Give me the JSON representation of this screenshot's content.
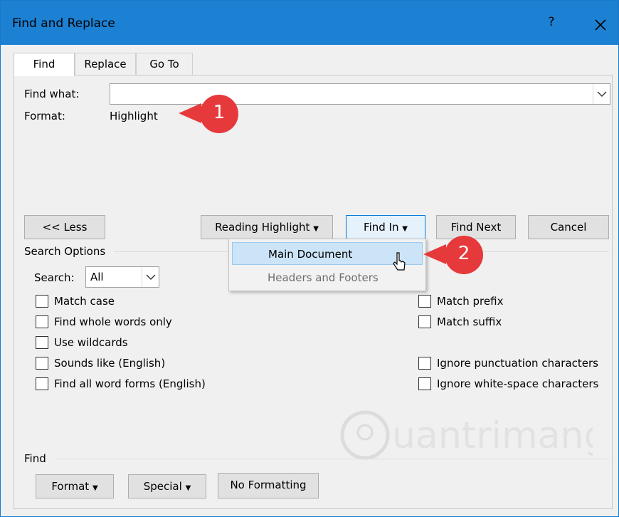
{
  "window": {
    "title": "Find and Replace",
    "help_label": "?",
    "close_icon": "close-icon",
    "title_bar_color": "#1c80d3"
  },
  "tabs": [
    {
      "label": "Find",
      "active": true
    },
    {
      "label": "Replace",
      "active": false
    },
    {
      "label": "Go To",
      "active": false
    }
  ],
  "find": {
    "find_what_label": "Find what:",
    "find_what_value": "",
    "format_label": "Format:",
    "format_value": "Highlight"
  },
  "buttons": {
    "less": "<< Less",
    "reading_highlight": "Reading Highlight",
    "find_in": "Find In",
    "find_next": "Find Next",
    "cancel": "Cancel"
  },
  "find_in_menu": {
    "items": [
      {
        "label": "Main Document",
        "highlighted": true
      },
      {
        "label": "Headers and Footers",
        "highlighted": false
      }
    ]
  },
  "search_options": {
    "group_label": "Search Options",
    "search_label": "Search:",
    "search_value": "All",
    "left_checks": [
      {
        "label": "Match case",
        "checked": false
      },
      {
        "label": "Find whole words only",
        "checked": false
      },
      {
        "label": "Use wildcards",
        "checked": false
      },
      {
        "label": "Sounds like (English)",
        "checked": false
      },
      {
        "label": "Find all word forms (English)",
        "checked": false
      }
    ],
    "right_checks": [
      {
        "label": "Match prefix",
        "checked": false
      },
      {
        "label": "Match suffix",
        "checked": false
      },
      {
        "label": "Ignore punctuation characters",
        "checked": false
      },
      {
        "label": "Ignore white-space characters",
        "checked": false
      }
    ]
  },
  "find_group": {
    "group_label": "Find",
    "format_button": "Format",
    "special_button": "Special",
    "no_formatting_button": "No Formatting"
  },
  "callouts": [
    {
      "number": "1"
    },
    {
      "number": "2"
    }
  ],
  "callout_color": "#e6393b",
  "watermark_text": "uantrimang"
}
